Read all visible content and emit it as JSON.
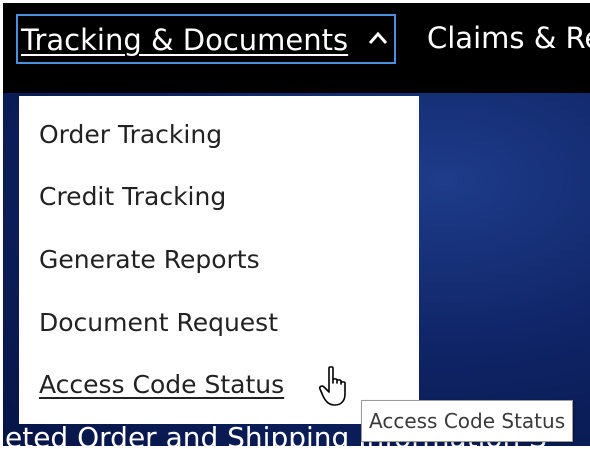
{
  "nav": {
    "active_item": "Tracking & Documents",
    "next_item": "Claims & Re"
  },
  "menu": {
    "items": [
      "Order Tracking",
      "Credit Tracking",
      "Generate Reports",
      "Document Request",
      "Access Code Status"
    ],
    "hovered_item": "Access Code Status"
  },
  "hero": {
    "partial_text": "eted Order and Shipping Information S"
  },
  "tooltip": {
    "text": "Access Code Status"
  },
  "icons": {
    "nav_chevron": "chevron-up-icon",
    "cursor": "hand-pointer-cursor"
  },
  "colors": {
    "navbar_bg": "#000000",
    "focus_outline": "#4a8fe0",
    "hero_bg": "#0f2466",
    "menu_bg": "#ffffff",
    "menu_text": "#222222"
  }
}
